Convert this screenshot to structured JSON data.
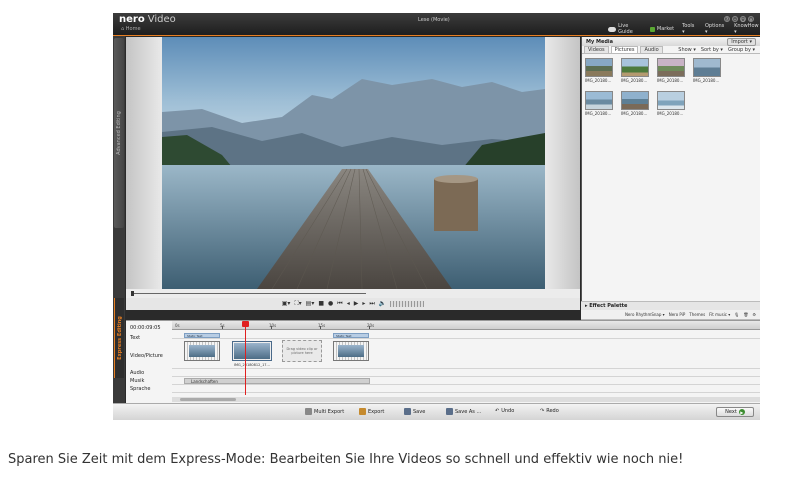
{
  "window": {
    "brand": "nero",
    "brand_sub": "Video",
    "home": "Home",
    "project_title": "Lese (Movie)"
  },
  "top_menu": {
    "live_guide": "Live Guide",
    "market": "Market",
    "tools": "Tools ▾",
    "options": "Options ▾",
    "knowhow": "KnowHow ▾"
  },
  "modes": {
    "advanced": "Advanced Editing",
    "express": "Express Editing"
  },
  "media": {
    "title": "My Media",
    "import": "Import ▾",
    "tabs": [
      "Videos",
      "Pictures",
      "Audio"
    ],
    "show": "Show ▾",
    "sort": "Sort by ▾",
    "group": "Group by ▾",
    "items": [
      {
        "caption": "IMG_20180..."
      },
      {
        "caption": "IMG_20180..."
      },
      {
        "caption": "IMG_20180..."
      },
      {
        "caption": "IMG_20180..."
      },
      {
        "caption": "IMG_20180..."
      },
      {
        "caption": "IMG_20180..."
      },
      {
        "caption": "IMG_20180..."
      }
    ]
  },
  "effects": {
    "title": "Effect Palette",
    "tools": [
      "Nero RhythmSnap ▾",
      "Nero PiP",
      "Themes",
      "Fit music ▾"
    ]
  },
  "timeline": {
    "time_code": "00:00:09:05",
    "ruler": [
      "0s",
      "5s",
      "10s",
      "15s",
      "20s"
    ],
    "tracks": [
      "Text",
      "Video/Picture",
      "Audio",
      "Musik",
      "Sprache"
    ],
    "text_clip": "Static Text",
    "clip_caption": "IMG_20180812_17...",
    "drop_hint": "Drag video clip or picture here",
    "music_clip": "Landschaften"
  },
  "bottom": {
    "multi_export": "Multi Export",
    "export": "Export",
    "save": "Save",
    "save_as": "Save As ...",
    "undo": "Undo",
    "redo": "Redo",
    "next": "Next"
  },
  "caption": "Sparen Sie Zeit mit dem Express-Mode: Bearbeiten Sie Ihre Videos so schnell und effektiv wie noch nie!"
}
